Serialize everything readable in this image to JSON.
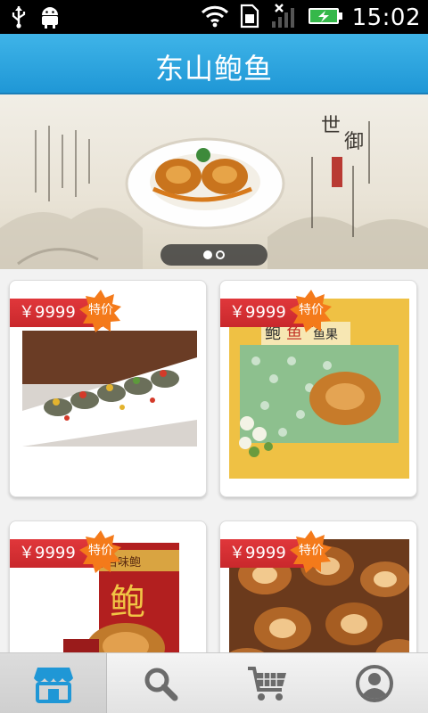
{
  "status_bar": {
    "time": "15:02",
    "icons": [
      "usb-icon",
      "android-debug-icon",
      "wifi-icon",
      "sim-icon",
      "signal-icon",
      "battery-charging-icon"
    ]
  },
  "header": {
    "title": "东山鲍鱼"
  },
  "banner": {
    "pages": 2,
    "active_page": 1
  },
  "products": [
    {
      "price": "￥9999",
      "badge": "特价"
    },
    {
      "price": "￥9999",
      "badge": "特价"
    },
    {
      "price": "￥9999",
      "badge": "特价"
    },
    {
      "price": "￥9999",
      "badge": "特价"
    }
  ],
  "tab_bar": {
    "tabs": [
      {
        "icon": "store-icon",
        "active": true
      },
      {
        "icon": "search-icon",
        "active": false
      },
      {
        "icon": "cart-icon",
        "active": false
      },
      {
        "icon": "user-icon",
        "active": false
      }
    ]
  },
  "colors": {
    "accent": "#27a2e0",
    "price_red": "#d2302f",
    "badge_orange": "#f47a1a"
  }
}
